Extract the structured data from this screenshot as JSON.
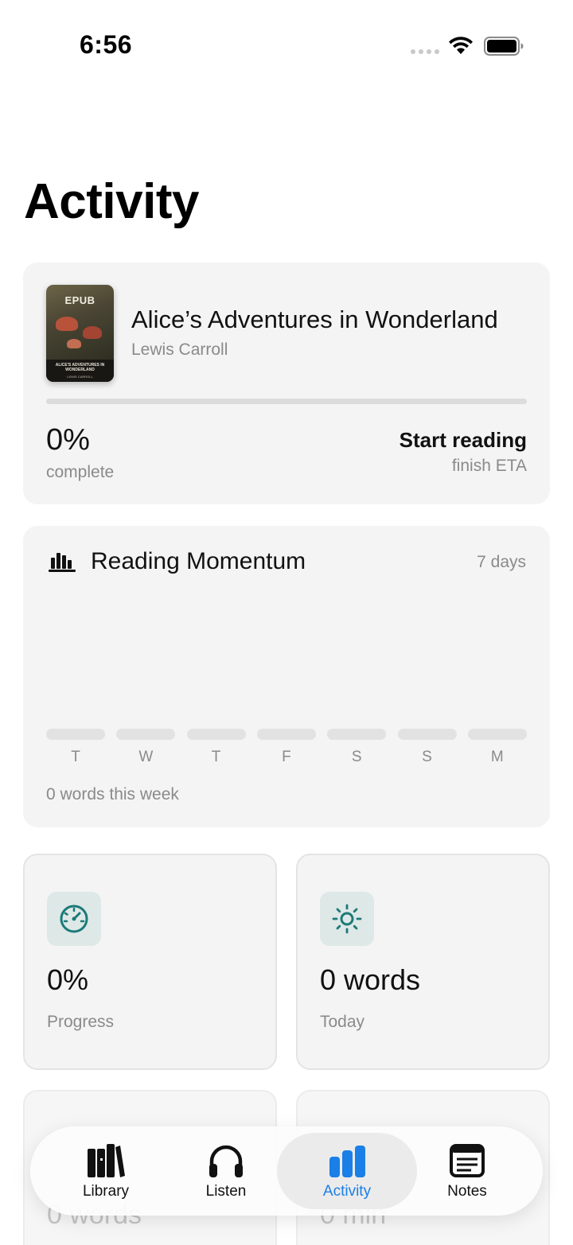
{
  "status_bar": {
    "time": "6:56"
  },
  "page": {
    "title": "Activity"
  },
  "book": {
    "cover_label": "EPUB",
    "cover_title": "ALICE'S ADVENTURES IN WONDERLAND",
    "cover_author": "LEWIS CARROLL",
    "title": "Alice’s Adventures in Wonderland",
    "author": "Lewis Carroll",
    "progress_fraction": 0,
    "percent": "0%",
    "percent_caption": "complete",
    "cta_label": "Start reading",
    "cta_caption": "finish ETA"
  },
  "momentum": {
    "title": "Reading Momentum",
    "range": "7 days",
    "days": [
      "T",
      "W",
      "T",
      "F",
      "S",
      "S",
      "M"
    ],
    "words_per_day": [
      0,
      0,
      0,
      0,
      0,
      0,
      0
    ],
    "caption": "0 words this week"
  },
  "stats": [
    {
      "icon": "gauge-icon",
      "value": "0%",
      "label": "Progress"
    },
    {
      "icon": "sun-icon",
      "value": "0 words",
      "label": "Today"
    }
  ],
  "stats_partial": [
    {
      "value": "0 words"
    },
    {
      "value": "0 min"
    }
  ],
  "tabbar": {
    "items": [
      {
        "label": "Library",
        "icon": "books-icon",
        "active": false
      },
      {
        "label": "Listen",
        "icon": "headphones-icon",
        "active": false
      },
      {
        "label": "Activity",
        "icon": "bar-chart-icon",
        "active": true
      },
      {
        "label": "Notes",
        "icon": "notes-icon",
        "active": false
      }
    ]
  },
  "colors": {
    "accent": "#1b7a78",
    "active_tab": "#1a7fe6",
    "muted": "#8a8a8a",
    "card": "#f4f4f4"
  }
}
